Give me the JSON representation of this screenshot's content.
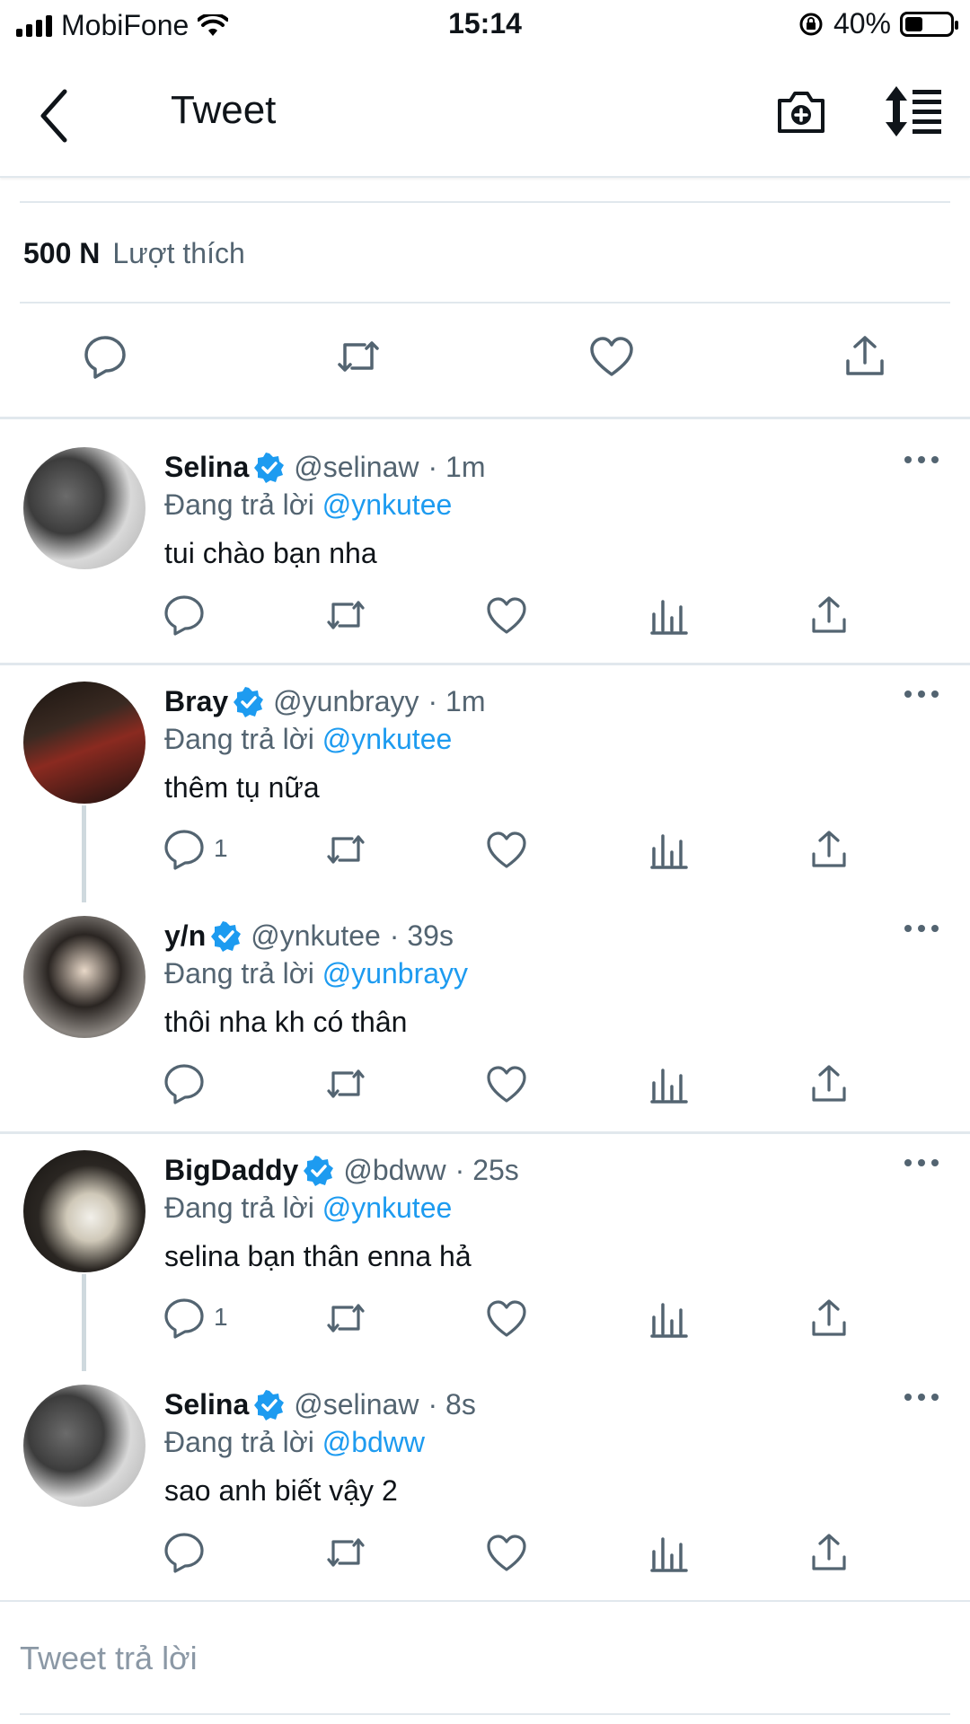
{
  "status_bar": {
    "carrier": "MobiFone",
    "time": "15:14",
    "battery": "40%",
    "battery_level": 0.4
  },
  "nav": {
    "title": "Tweet"
  },
  "likes": {
    "count": "500 N",
    "label": "Lượt thích"
  },
  "tweets": [
    {
      "name": "Selina",
      "handle": "@selinaw",
      "time": "· 1m",
      "reply_prefix": "Đang trả lời",
      "reply_to": "@ynkutee",
      "text": "tui chào bạn nha",
      "reply_count": ""
    },
    {
      "name": "Bray",
      "handle": "@yunbrayy",
      "time": "· 1m",
      "reply_prefix": "Đang trả lời",
      "reply_to": "@ynkutee",
      "text": "thêm tụ nữa",
      "reply_count": "1"
    },
    {
      "name": "y/n",
      "handle": "@ynkutee",
      "time": "· 39s",
      "reply_prefix": "Đang trả lời",
      "reply_to": "@yunbrayy",
      "text": "thôi nha kh có thân",
      "reply_count": ""
    },
    {
      "name": "BigDaddy",
      "handle": "@bdww",
      "time": "· 25s",
      "reply_prefix": "Đang trả lời",
      "reply_to": "@ynkutee",
      "text": "selina bạn thân enna hả",
      "reply_count": "1"
    },
    {
      "name": "Selina",
      "handle": "@selinaw",
      "time": "· 8s",
      "reply_prefix": "Đang trả lời",
      "reply_to": "@bdww",
      "text": "sao anh biết vậy 2",
      "reply_count": ""
    }
  ],
  "compose": {
    "placeholder": "Tweet trả lời"
  },
  "colors": {
    "accent": "#1d9bf0",
    "secondary_text": "#536471",
    "divider": "#e1e8ed"
  },
  "icons": [
    "back-icon",
    "camera-plus-icon",
    "sort-icon",
    "reply-icon",
    "retweet-icon",
    "like-icon",
    "share-icon",
    "analytics-icon",
    "more-icon",
    "verified-icon"
  ]
}
